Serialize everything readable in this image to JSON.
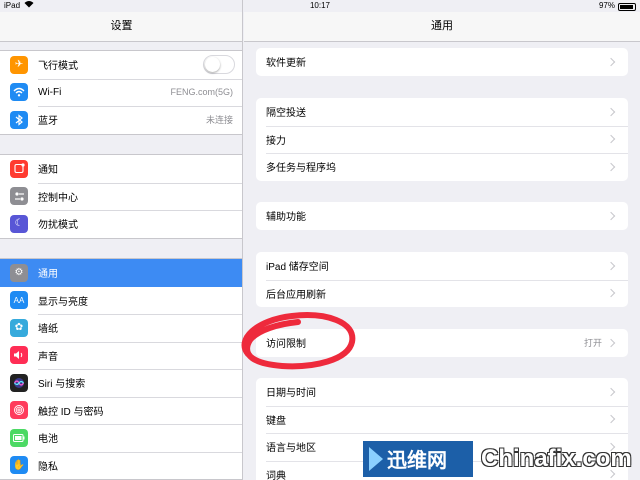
{
  "status_bar": {
    "device": "iPad",
    "time": "10:17",
    "battery": "97%"
  },
  "left": {
    "title": "设置",
    "groups": [
      [
        {
          "label": "飞行模式",
          "icon": "airplane-icon",
          "color": "#ff9500",
          "value": "",
          "toggle": true
        },
        {
          "label": "Wi-Fi",
          "icon": "wifi-icon",
          "color": "#1f8bf3",
          "value": "FENG.com(5G)"
        },
        {
          "label": "蓝牙",
          "icon": "bluetooth-icon",
          "color": "#1f8bf3",
          "value": "未连接"
        }
      ],
      [
        {
          "label": "通知",
          "icon": "notifications-icon",
          "color": "#ff3b30"
        },
        {
          "label": "控制中心",
          "icon": "control-center-icon",
          "color": "#8e8e93"
        },
        {
          "label": "勿扰模式",
          "icon": "moon-icon",
          "color": "#5856d6"
        }
      ],
      [
        {
          "label": "通用",
          "icon": "gear-icon",
          "color": "#8e8e93",
          "selected": true
        },
        {
          "label": "显示与亮度",
          "icon": "display-icon",
          "color": "#1f8bf3"
        },
        {
          "label": "墙纸",
          "icon": "wallpaper-icon",
          "color": "#36aadc"
        },
        {
          "label": "声音",
          "icon": "sound-icon",
          "color": "#ff2d55"
        },
        {
          "label": "Siri 与搜索",
          "icon": "siri-icon",
          "color": "#222222"
        },
        {
          "label": "触控 ID 与密码",
          "icon": "fingerprint-icon",
          "color": "#ff3b5c"
        },
        {
          "label": "电池",
          "icon": "battery-icon",
          "color": "#4cd964"
        },
        {
          "label": "隐私",
          "icon": "hand-icon",
          "color": "#1f8bf3"
        }
      ]
    ]
  },
  "right": {
    "title": "通用",
    "groups": [
      [
        {
          "label": "软件更新"
        }
      ],
      [
        {
          "label": "隔空投送"
        },
        {
          "label": "接力"
        },
        {
          "label": "多任务与程序坞"
        }
      ],
      [
        {
          "label": "辅助功能"
        }
      ],
      [
        {
          "label": "iPad 储存空间"
        },
        {
          "label": "后台应用刷新"
        }
      ],
      [
        {
          "label": "访问限制",
          "value": "打开"
        }
      ],
      [
        {
          "label": "日期与时间"
        },
        {
          "label": "键盘"
        },
        {
          "label": "语言与地区"
        },
        {
          "label": "词典"
        }
      ]
    ]
  },
  "annotation": {
    "color": "#ee2a3c"
  },
  "watermark": {
    "cn": "迅维网",
    "en": "Chinafix.com"
  }
}
